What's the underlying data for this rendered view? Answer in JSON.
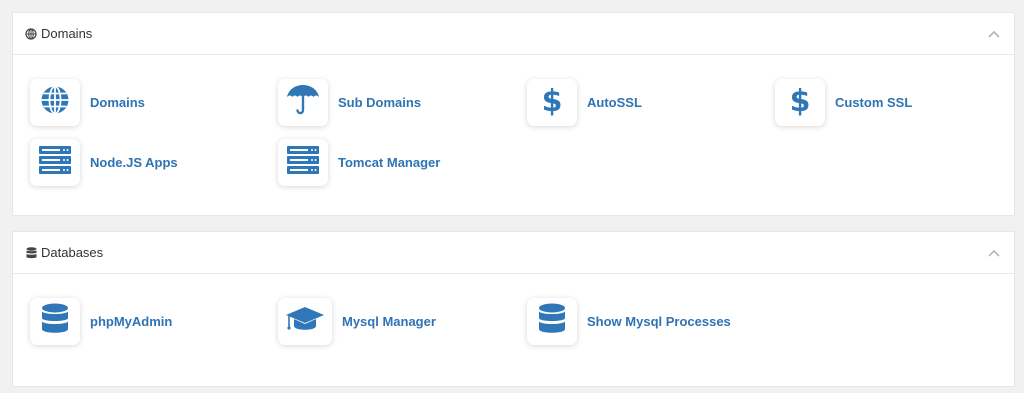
{
  "colors": {
    "accent": "#2e73b3",
    "icon": "#2f77b6",
    "page_bg": "#f1f1f1",
    "panel_bg": "#ffffff"
  },
  "domains_panel": {
    "title": "Domains",
    "header_icon": "globe-icon",
    "collapse_icon": "chevron-up-icon",
    "items": [
      {
        "label": "Domains",
        "icon": "globe-icon"
      },
      {
        "label": "Sub Domains",
        "icon": "umbrella-icon"
      },
      {
        "label": "AutoSSL",
        "icon": "dollar-icon"
      },
      {
        "label": "Custom SSL",
        "icon": "dollar-icon"
      },
      {
        "label": "Node.JS Apps",
        "icon": "server-icon"
      },
      {
        "label": "Tomcat Manager",
        "icon": "server-icon"
      }
    ]
  },
  "databases_panel": {
    "title": "Databases",
    "header_icon": "database-icon",
    "collapse_icon": "chevron-up-icon",
    "items": [
      {
        "label": "phpMyAdmin",
        "icon": "database-icon"
      },
      {
        "label": "Mysql Manager",
        "icon": "graduation-cap-icon"
      },
      {
        "label": "Show Mysql Processes",
        "icon": "database-icon"
      }
    ]
  }
}
